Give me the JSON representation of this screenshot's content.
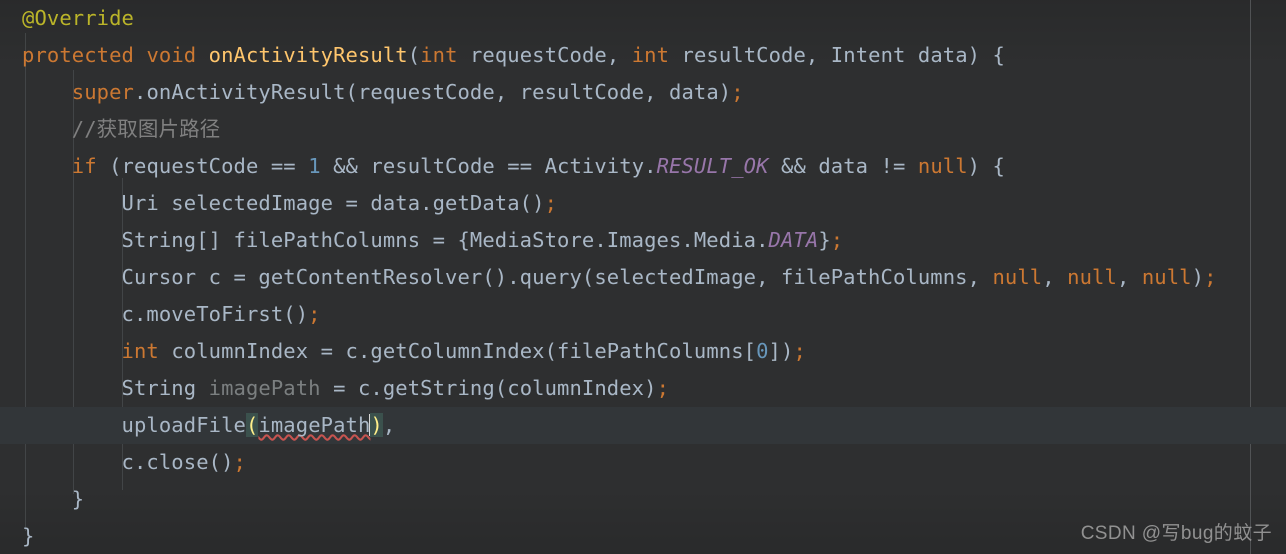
{
  "editor": {
    "language": "Java",
    "theme": "Darcula",
    "background_color": "#2e2f30",
    "current_line_color": "#323639",
    "default_text_color": "#a9b7c6",
    "keyword_color": "#cc7832",
    "annotation_color": "#bbb529",
    "method_color": "#ffc66d",
    "number_color": "#6897bb",
    "constant_color": "#9876aa",
    "comment_color": "#808080",
    "error_underline_color": "#c75450",
    "bracket_highlight_color": "#3b514d",
    "lines": [
      {
        "id": "line-annotation-override",
        "indent": 0,
        "current": false,
        "text": "@Override"
      },
      {
        "id": "line-method-signature",
        "indent": 0,
        "current": false,
        "text": "protected void onActivityResult(int requestCode, int resultCode, Intent data) {"
      },
      {
        "id": "line-super-call",
        "indent": 1,
        "current": false,
        "text": "super.onActivityResult(requestCode, resultCode, data);"
      },
      {
        "id": "line-comment-chinese",
        "indent": 1,
        "current": false,
        "text": "//获取图片路径"
      },
      {
        "id": "line-if-condition",
        "indent": 1,
        "current": false,
        "text": "if (requestCode == 1 && resultCode == Activity.RESULT_OK && data != null) {"
      },
      {
        "id": "line-uri-selected-image",
        "indent": 2,
        "current": false,
        "text": "Uri selectedImage = data.getData();"
      },
      {
        "id": "line-file-path-columns",
        "indent": 2,
        "current": false,
        "text": "String[] filePathColumns = {MediaStore.Images.Media.DATA};"
      },
      {
        "id": "line-cursor-query",
        "indent": 2,
        "current": false,
        "text": "Cursor c = getContentResolver().query(selectedImage, filePathColumns, null, null, null);"
      },
      {
        "id": "line-move-to-first",
        "indent": 2,
        "current": false,
        "text": "c.moveToFirst();"
      },
      {
        "id": "line-column-index",
        "indent": 2,
        "current": false,
        "text": "int columnIndex = c.getColumnIndex(filePathColumns[0]);"
      },
      {
        "id": "line-image-path",
        "indent": 2,
        "current": false,
        "text": "String imagePath = c.getString(columnIndex);"
      },
      {
        "id": "line-upload-file",
        "indent": 2,
        "current": true,
        "text": "uploadFile(imagePath),"
      },
      {
        "id": "line-cursor-close",
        "indent": 2,
        "current": false,
        "text": "c.close();"
      },
      {
        "id": "line-close-if-brace",
        "indent": 1,
        "current": false,
        "text": "}"
      },
      {
        "id": "line-close-method-brace",
        "indent": 0,
        "current": false,
        "text": "}"
      }
    ]
  },
  "watermark": {
    "text": "CSDN @写bug的蚊子"
  }
}
